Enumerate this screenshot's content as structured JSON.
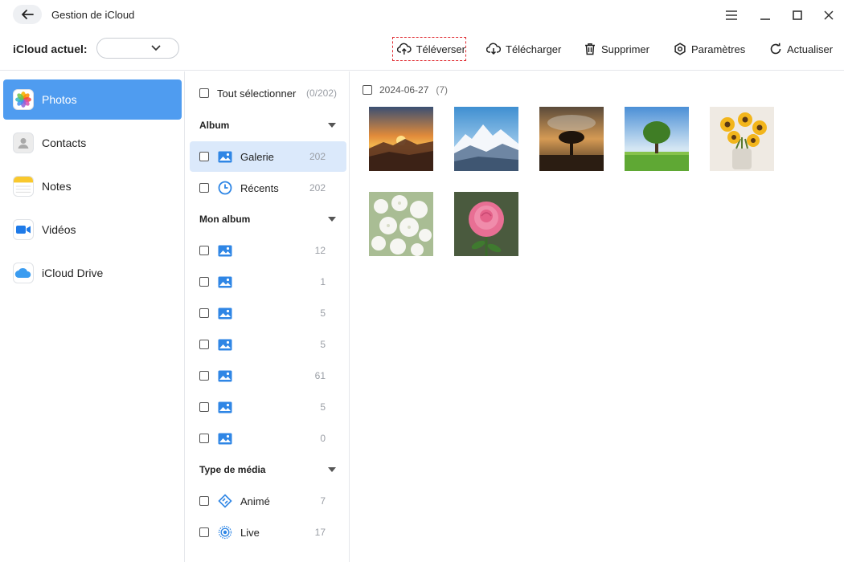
{
  "window": {
    "title": "Gestion de iCloud"
  },
  "toolbar": {
    "icloud_label": "iCloud actuel:",
    "icloud_value": "",
    "upload": "Téléverser",
    "download": "Télécharger",
    "delete": "Supprimer",
    "settings": "Paramètres",
    "refresh": "Actualiser"
  },
  "sidebar": {
    "items": [
      {
        "label": "Photos",
        "icon": "photos-app-icon"
      },
      {
        "label": "Contacts",
        "icon": "contacts-app-icon"
      },
      {
        "label": "Notes",
        "icon": "notes-app-icon"
      },
      {
        "label": "Vidéos",
        "icon": "videos-app-icon"
      },
      {
        "label": "iCloud Drive",
        "icon": "icloud-drive-icon"
      }
    ]
  },
  "albums": {
    "select_all_label": "Tout sélectionner",
    "select_all_count": "(0/202)",
    "album_section": "Album",
    "album_items": [
      {
        "label": "Galerie",
        "count": "202"
      },
      {
        "label": "Récents",
        "count": "202"
      }
    ],
    "my_album_section": "Mon album",
    "my_album_counts": [
      "12",
      "1",
      "5",
      "5",
      "61",
      "5",
      "0"
    ],
    "media_type_section": "Type de média",
    "media_items": [
      {
        "label": "Animé",
        "count": "7"
      },
      {
        "label": "Live",
        "count": "17"
      }
    ]
  },
  "content": {
    "date": "2024-06-27",
    "count": "(7)",
    "photos": [
      "sunset-mountains-photo",
      "snowy-mountains-photo",
      "lone-tree-sunset-photo",
      "green-tree-field-photo",
      "sunflowers-vase-photo",
      "white-flowers-photo",
      "pink-rose-photo"
    ]
  },
  "colors": {
    "accent": "#4f9cf0",
    "selected_row": "#dbe9fb",
    "upload_border": "#e0282e"
  }
}
